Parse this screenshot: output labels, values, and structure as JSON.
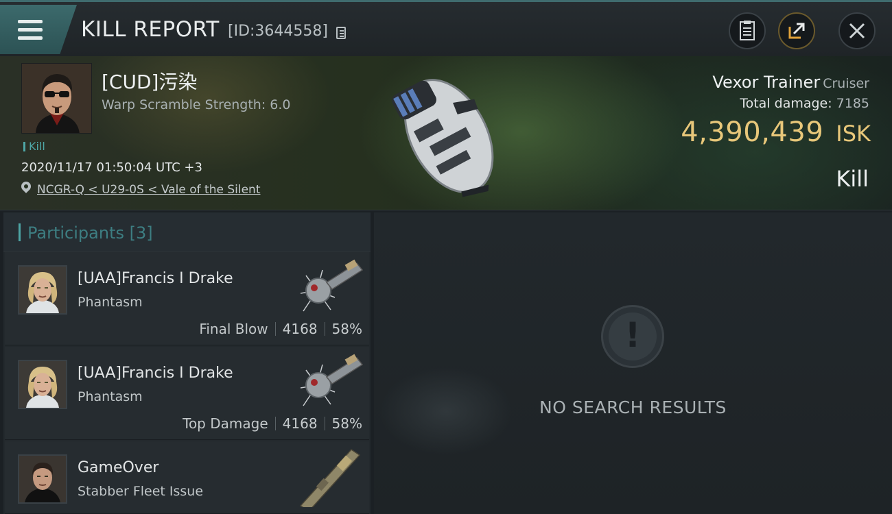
{
  "header": {
    "title": "KILL REPORT",
    "report_id": "[ID:3644558]"
  },
  "victim": {
    "name": "[CUD]污染",
    "warp_scramble": "Warp Scramble Strength: 6.0",
    "tag": "Kill",
    "datetime": "2020/11/17 01:50:04 UTC +3",
    "location": "NCGR-Q < U29-0S < Vale of the Silent",
    "ship_name": "Vexor Trainer",
    "ship_class": "Cruiser",
    "total_damage_label": "Total damage:",
    "total_damage": "7185",
    "isk_value": "4,390,439",
    "isk_unit": "ISK",
    "result": "Kill"
  },
  "participants": {
    "title": "Participants",
    "count": "[3]",
    "rows": [
      {
        "name": "[UAA]Francis I Drake",
        "ship": "Phantasm",
        "tag": "Final Blow",
        "damage": "4168",
        "percent": "58%"
      },
      {
        "name": "[UAA]Francis I Drake",
        "ship": "Phantasm",
        "tag": "Top Damage",
        "damage": "4168",
        "percent": "58%"
      },
      {
        "name": "GameOver",
        "ship": "Stabber Fleet Issue",
        "tag": "",
        "damage": "",
        "percent": ""
      }
    ]
  },
  "empty_state": {
    "message": "NO SEARCH RESULTS"
  },
  "colors": {
    "accent": "#4ea6a6",
    "isk": "#e8c77a"
  }
}
